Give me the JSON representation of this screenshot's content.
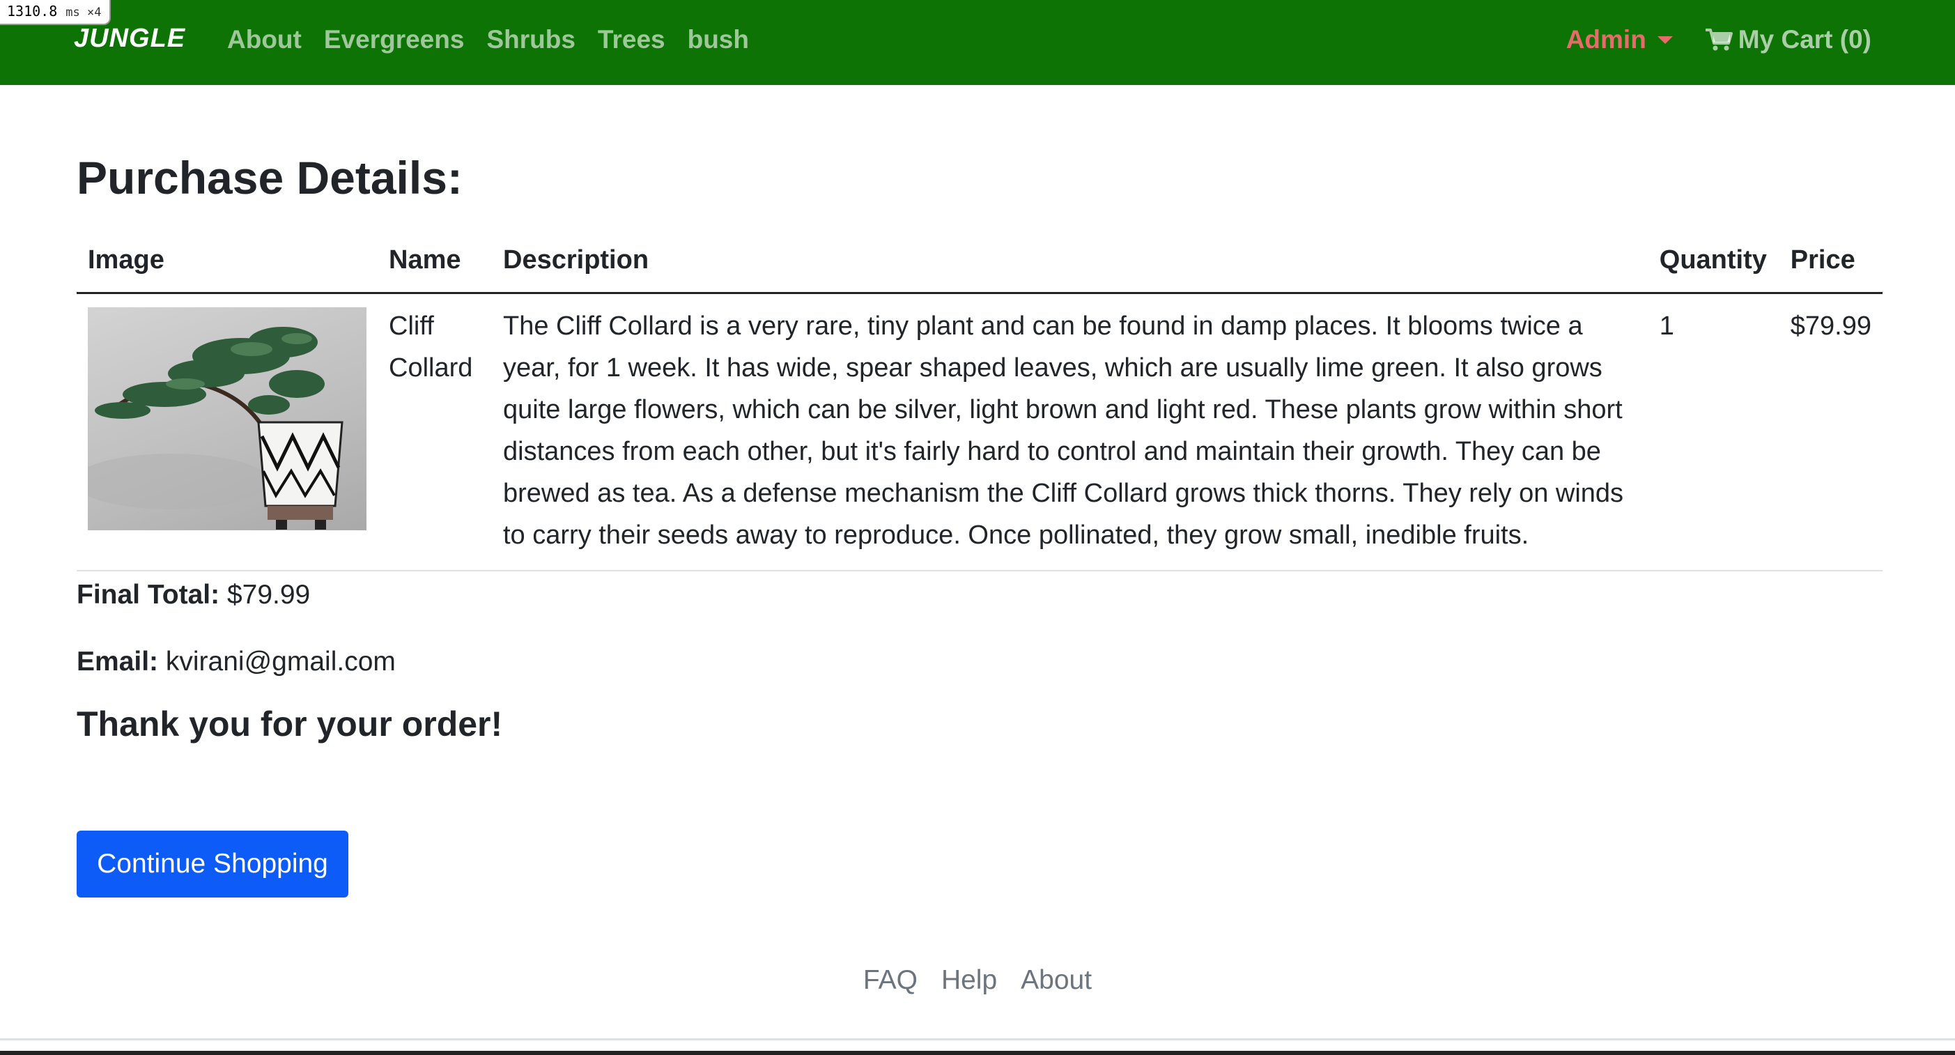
{
  "perf_badge": {
    "value": "1310.8",
    "unit": "ms ×4"
  },
  "navbar": {
    "brand": "JUNGLE",
    "links": [
      "About",
      "Evergreens",
      "Shrubs",
      "Trees",
      "bush"
    ],
    "admin_label": "Admin",
    "cart_label": "My Cart (0)",
    "background_color": "#0d7304",
    "admin_color": "#e86b6b"
  },
  "page": {
    "title": "Purchase Details:"
  },
  "table": {
    "headers": {
      "image": "Image",
      "name": "Name",
      "description": "Description",
      "quantity": "Quantity",
      "price": "Price"
    },
    "rows": [
      {
        "image_icon": "bonsai-plant-photo",
        "name": "Cliff Collard",
        "description": "The Cliff Collard is a very rare, tiny plant and can be found in damp places. It blooms twice a year, for 1 week. It has wide, spear shaped leaves, which are usually lime green. It also grows quite large flowers, which can be silver, light brown and light red. These plants grow within short distances from each other, but it's fairly hard to control and maintain their growth. They can be brewed as tea. As a defense mechanism the Cliff Collard grows thick thorns. They rely on winds to carry their seeds away to reproduce. Once pollinated, they grow small, inedible fruits.",
        "quantity": "1",
        "price": "$79.99"
      }
    ]
  },
  "summary": {
    "final_total_label": "Final Total:",
    "final_total_value": "$79.99",
    "email_label": "Email:",
    "email_value": "kvirani@gmail.com",
    "thanks": "Thank you for your order!"
  },
  "actions": {
    "continue_label": "Continue Shopping",
    "continue_color": "#0d5cf7"
  },
  "footer": {
    "links": [
      "FAQ",
      "Help",
      "About"
    ]
  }
}
